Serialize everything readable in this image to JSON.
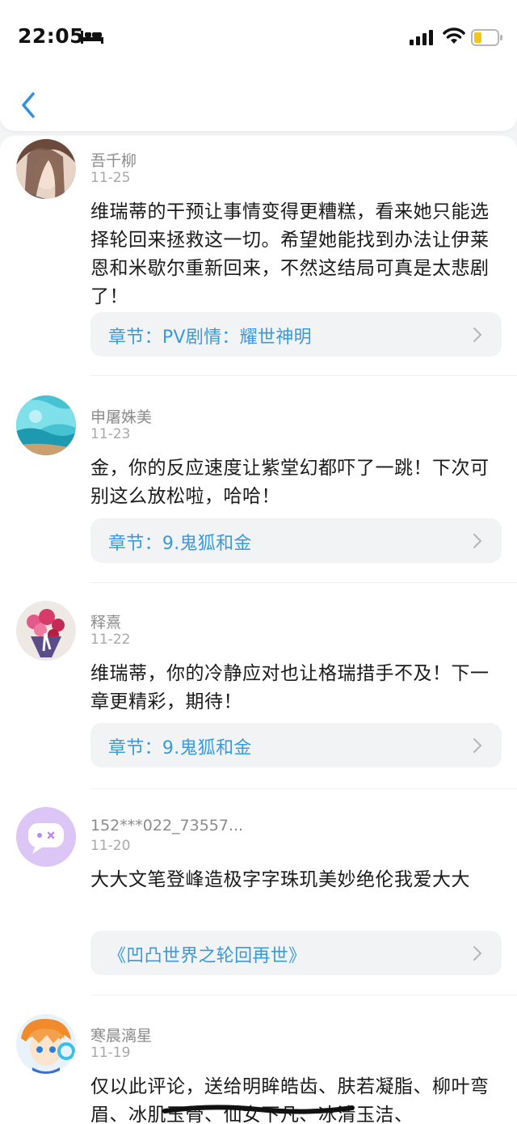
{
  "status": {
    "time": "22:05"
  },
  "comments": [
    {
      "user": "吾千柳",
      "date": "11-25",
      "text": "维瑞蒂的干预让事情变得更糟糕，看来她只能选择轮回来拯救这一切。希望她能找到办法让伊莱恩和米歇尔重新回来，不然这结局可真是太悲剧了！",
      "link": "章节：PV剧情：耀世神明"
    },
    {
      "user": "申屠姝美",
      "date": "11-23",
      "text": "金，你的反应速度让紫堂幻都吓了一跳！下次可别这么放松啦，哈哈！",
      "link": "章节：9.鬼狐和金"
    },
    {
      "user": "释熹",
      "date": "11-22",
      "text": "维瑞蒂，你的冷静应对也让格瑞措手不及！下一章更精彩，期待！",
      "link": "章节：9.鬼狐和金"
    },
    {
      "user": "152***022_73557...",
      "date": "11-20",
      "text": "大大文笔登峰造极字字珠玑美妙绝伦我爱大大",
      "link": "《凹凸世界之轮回再世》"
    },
    {
      "user": "寒晨漓星",
      "date": "11-19",
      "text": "仅以此评论，送给明眸皓齿、肤若凝脂、柳叶弯眉、冰肌玉骨、仙女下凡、冰清玉洁、"
    }
  ]
}
